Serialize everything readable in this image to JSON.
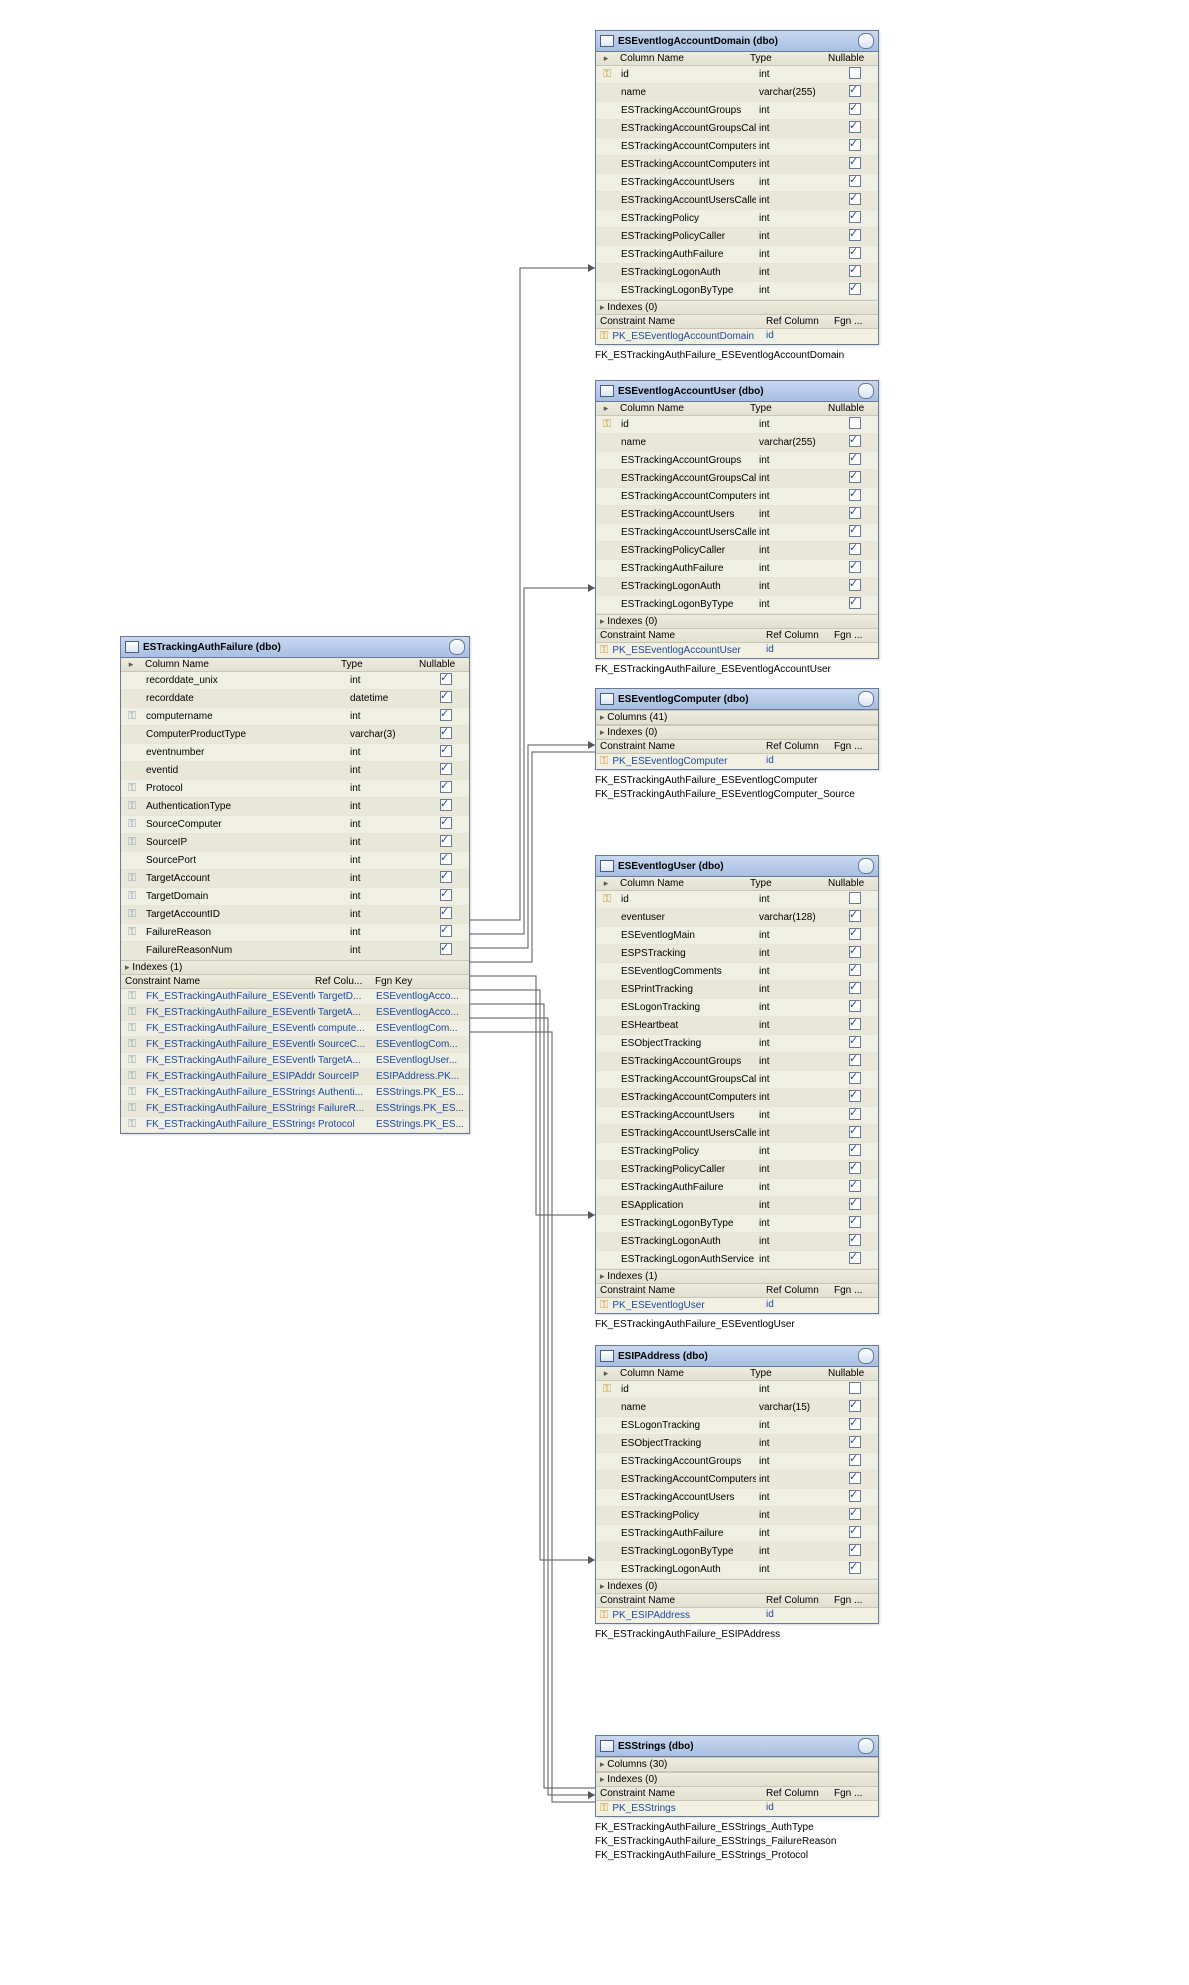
{
  "tables": {
    "accDomain": {
      "title": "ESEventlogAccountDomain (dbo)",
      "header": [
        "Column Name",
        "Type",
        "Nullable"
      ],
      "rows": [
        {
          "pk": true,
          "name": "id",
          "type": "int",
          "null": false
        },
        {
          "name": "name",
          "type": "varchar(255)",
          "null": true
        },
        {
          "name": "ESTrackingAccountGroups",
          "type": "int",
          "null": true
        },
        {
          "name": "ESTrackingAccountGroupsCaller",
          "type": "int",
          "null": true
        },
        {
          "name": "ESTrackingAccountComputersCli",
          "type": "int",
          "null": true
        },
        {
          "name": "ESTrackingAccountComputersClr",
          "type": "int",
          "null": true
        },
        {
          "name": "ESTrackingAccountUsers",
          "type": "int",
          "null": true
        },
        {
          "name": "ESTrackingAccountUsersCaller",
          "type": "int",
          "null": true
        },
        {
          "name": "ESTrackingPolicy",
          "type": "int",
          "null": true
        },
        {
          "name": "ESTrackingPolicyCaller",
          "type": "int",
          "null": true
        },
        {
          "name": "ESTrackingAuthFailure",
          "type": "int",
          "null": true
        },
        {
          "name": "ESTrackingLogonAuth",
          "type": "int",
          "null": true
        },
        {
          "name": "ESTrackingLogonByType",
          "type": "int",
          "null": true
        }
      ],
      "indexes": "Indexes (0)",
      "chdr": [
        "Constraint Name",
        "Ref Column",
        "Fgn ..."
      ],
      "constraints": [
        {
          "name": "PK_ESEventlogAccountDomain",
          "ref": "id"
        }
      ],
      "rel": [
        "FK_ESTrackingAuthFailure_ESEventlogAccountDomain"
      ]
    },
    "accUser": {
      "title": "ESEventlogAccountUser (dbo)",
      "header": [
        "Column Name",
        "Type",
        "Nullable"
      ],
      "rows": [
        {
          "pk": true,
          "name": "id",
          "type": "int",
          "null": false
        },
        {
          "name": "name",
          "type": "varchar(255)",
          "null": true
        },
        {
          "name": "ESTrackingAccountGroups",
          "type": "int",
          "null": true
        },
        {
          "name": "ESTrackingAccountGroupsCaller",
          "type": "int",
          "null": true
        },
        {
          "name": "ESTrackingAccountComputersClr",
          "type": "int",
          "null": true
        },
        {
          "name": "ESTrackingAccountUsers",
          "type": "int",
          "null": true
        },
        {
          "name": "ESTrackingAccountUsersCaller",
          "type": "int",
          "null": true
        },
        {
          "name": "ESTrackingPolicyCaller",
          "type": "int",
          "null": true
        },
        {
          "name": "ESTrackingAuthFailure",
          "type": "int",
          "null": true
        },
        {
          "name": "ESTrackingLogonAuth",
          "type": "int",
          "null": true
        },
        {
          "name": "ESTrackingLogonByType",
          "type": "int",
          "null": true
        }
      ],
      "indexes": "Indexes (0)",
      "chdr": [
        "Constraint Name",
        "Ref Column",
        "Fgn ..."
      ],
      "constraints": [
        {
          "name": "PK_ESEventlogAccountUser",
          "ref": "id"
        }
      ],
      "rel": [
        "FK_ESTrackingAuthFailure_ESEventlogAccountUser"
      ]
    },
    "tracking": {
      "title": "ESTrackingAuthFailure (dbo)",
      "header": [
        "Column Name",
        "Type",
        "Nullable"
      ],
      "rows": [
        {
          "name": "recorddate_unix",
          "type": "int",
          "null": true
        },
        {
          "name": "recorddate",
          "type": "datetime",
          "null": true
        },
        {
          "fk": true,
          "name": "computername",
          "type": "int",
          "null": true
        },
        {
          "name": "ComputerProductType",
          "type": "varchar(3)",
          "null": true
        },
        {
          "name": "eventnumber",
          "type": "int",
          "null": true
        },
        {
          "name": "eventid",
          "type": "int",
          "null": true
        },
        {
          "fk": true,
          "name": "Protocol",
          "type": "int",
          "null": true
        },
        {
          "fk": true,
          "name": "AuthenticationType",
          "type": "int",
          "null": true
        },
        {
          "fk": true,
          "name": "SourceComputer",
          "type": "int",
          "null": true
        },
        {
          "fk": true,
          "name": "SourceIP",
          "type": "int",
          "null": true
        },
        {
          "name": "SourcePort",
          "type": "int",
          "null": true
        },
        {
          "fk": true,
          "name": "TargetAccount",
          "type": "int",
          "null": true
        },
        {
          "fk": true,
          "name": "TargetDomain",
          "type": "int",
          "null": true
        },
        {
          "fk": true,
          "name": "TargetAccountID",
          "type": "int",
          "null": true
        },
        {
          "fk": true,
          "name": "FailureReason",
          "type": "int",
          "null": true
        },
        {
          "name": "FailureReasonNum",
          "type": "int",
          "null": true
        }
      ],
      "indexes": "Indexes (1)",
      "chdr": [
        "Constraint Name",
        "Ref Colu...",
        "Fgn Key"
      ],
      "constraints": [
        {
          "name": "FK_ESTrackingAuthFailure_ESEventlogAccountDomain",
          "ref": "TargetD...",
          "fk": "ESEventlogAcco..."
        },
        {
          "name": "FK_ESTrackingAuthFailure_ESEventlogAccountUser",
          "ref": "TargetA...",
          "fk": "ESEventlogAcco..."
        },
        {
          "name": "FK_ESTrackingAuthFailure_ESEventlogComputer",
          "ref": "compute...",
          "fk": "ESEventlogCom..."
        },
        {
          "name": "FK_ESTrackingAuthFailure_ESEventlogComputer_Source",
          "ref": "SourceC...",
          "fk": "ESEventlogCom..."
        },
        {
          "name": "FK_ESTrackingAuthFailure_ESEventlogUser",
          "ref": "TargetA...",
          "fk": "ESEventlogUser..."
        },
        {
          "name": "FK_ESTrackingAuthFailure_ESIPAddress",
          "ref": "SourceIP",
          "fk": "ESIPAddress.PK..."
        },
        {
          "name": "FK_ESTrackingAuthFailure_ESStrings_AuthType",
          "ref": "Authenti...",
          "fk": "ESStrings.PK_ES..."
        },
        {
          "name": "FK_ESTrackingAuthFailure_ESStrings_FailureReason",
          "ref": "FailureR...",
          "fk": "ESStrings.PK_ES..."
        },
        {
          "name": "FK_ESTrackingAuthFailure_ESStrings_Protocol",
          "ref": "Protocol",
          "fk": "ESStrings.PK_ES..."
        }
      ]
    },
    "computer": {
      "title": "ESEventlogComputer (dbo)",
      "collapsedCols": "Columns (41)",
      "indexes": "Indexes (0)",
      "chdr": [
        "Constraint Name",
        "Ref Column",
        "Fgn ..."
      ],
      "constraints": [
        {
          "name": "PK_ESEventlogComputer",
          "ref": "id"
        }
      ],
      "rel": [
        "FK_ESTrackingAuthFailure_ESEventlogComputer",
        "FK_ESTrackingAuthFailure_ESEventlogComputer_Source"
      ]
    },
    "euser": {
      "title": "ESEventlogUser (dbo)",
      "header": [
        "Column Name",
        "Type",
        "Nullable"
      ],
      "rows": [
        {
          "pk": true,
          "name": "id",
          "type": "int",
          "null": false
        },
        {
          "name": "eventuser",
          "type": "varchar(128)",
          "null": true
        },
        {
          "name": "ESEventlogMain",
          "type": "int",
          "null": true
        },
        {
          "name": "ESPSTracking",
          "type": "int",
          "null": true
        },
        {
          "name": "ESEventlogComments",
          "type": "int",
          "null": true
        },
        {
          "name": "ESPrintTracking",
          "type": "int",
          "null": true
        },
        {
          "name": "ESLogonTracking",
          "type": "int",
          "null": true
        },
        {
          "name": "ESHeartbeat",
          "type": "int",
          "null": true
        },
        {
          "name": "ESObjectTracking",
          "type": "int",
          "null": true
        },
        {
          "name": "ESTrackingAccountGroups",
          "type": "int",
          "null": true
        },
        {
          "name": "ESTrackingAccountGroupsCaller",
          "type": "int",
          "null": true
        },
        {
          "name": "ESTrackingAccountComputersClr",
          "type": "int",
          "null": true
        },
        {
          "name": "ESTrackingAccountUsers",
          "type": "int",
          "null": true
        },
        {
          "name": "ESTrackingAccountUsersCaller",
          "type": "int",
          "null": true
        },
        {
          "name": "ESTrackingPolicy",
          "type": "int",
          "null": true
        },
        {
          "name": "ESTrackingPolicyCaller",
          "type": "int",
          "null": true
        },
        {
          "name": "ESTrackingAuthFailure",
          "type": "int",
          "null": true
        },
        {
          "name": "ESApplication",
          "type": "int",
          "null": true
        },
        {
          "name": "ESTrackingLogonByType",
          "type": "int",
          "null": true
        },
        {
          "name": "ESTrackingLogonAuth",
          "type": "int",
          "null": true
        },
        {
          "name": "ESTrackingLogonAuthService",
          "type": "int",
          "null": true
        }
      ],
      "indexes": "Indexes (1)",
      "chdr": [
        "Constraint Name",
        "Ref Column",
        "Fgn ..."
      ],
      "constraints": [
        {
          "name": "PK_ESEventlogUser",
          "ref": "id"
        }
      ],
      "rel": [
        "FK_ESTrackingAuthFailure_ESEventlogUser"
      ]
    },
    "ip": {
      "title": "ESIPAddress (dbo)",
      "header": [
        "Column Name",
        "Type",
        "Nullable"
      ],
      "rows": [
        {
          "pk": true,
          "name": "id",
          "type": "int",
          "null": false
        },
        {
          "name": "name",
          "type": "varchar(15)",
          "null": true
        },
        {
          "name": "ESLogonTracking",
          "type": "int",
          "null": true
        },
        {
          "name": "ESObjectTracking",
          "type": "int",
          "null": true
        },
        {
          "name": "ESTrackingAccountGroups",
          "type": "int",
          "null": true
        },
        {
          "name": "ESTrackingAccountComputers",
          "type": "int",
          "null": true
        },
        {
          "name": "ESTrackingAccountUsers",
          "type": "int",
          "null": true
        },
        {
          "name": "ESTrackingPolicy",
          "type": "int",
          "null": true
        },
        {
          "name": "ESTrackingAuthFailure",
          "type": "int",
          "null": true
        },
        {
          "name": "ESTrackingLogonByType",
          "type": "int",
          "null": true
        },
        {
          "name": "ESTrackingLogonAuth",
          "type": "int",
          "null": true
        }
      ],
      "indexes": "Indexes (0)",
      "chdr": [
        "Constraint Name",
        "Ref Column",
        "Fgn ..."
      ],
      "constraints": [
        {
          "name": "PK_ESIPAddress",
          "ref": "id"
        }
      ],
      "rel": [
        "FK_ESTrackingAuthFailure_ESIPAddress"
      ]
    },
    "strings": {
      "title": "ESStrings (dbo)",
      "collapsedCols": "Columns (30)",
      "indexes": "Indexes (0)",
      "chdr": [
        "Constraint Name",
        "Ref Column",
        "Fgn ..."
      ],
      "constraints": [
        {
          "name": "PK_ESStrings",
          "ref": "id"
        }
      ],
      "rel": [
        "FK_ESTrackingAuthFailure_ESStrings_AuthType",
        "FK_ESTrackingAuthFailure_ESStrings_FailureReason",
        "FK_ESTrackingAuthFailure_ESStrings_Protocol"
      ]
    }
  }
}
